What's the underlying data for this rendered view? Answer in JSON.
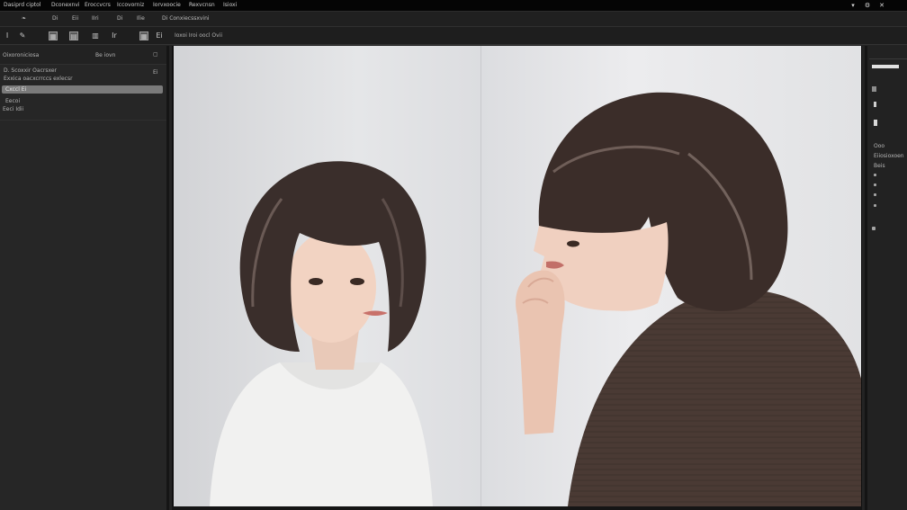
{
  "menubar": {
    "items": [
      "Dasiprd ciptol",
      "Dconexnvi",
      "Eroccvcrs",
      "Iccovorniz",
      "Iorvxoocie",
      "Rexvcnsn",
      "Isioxi"
    ],
    "window_controls": [
      "▾",
      "⚙",
      "✕"
    ]
  },
  "tabs": [
    "❧",
    "Di",
    "Eii",
    "IIri",
    "Di",
    "Ilie",
    "Di Conxiecssxvini"
  ],
  "toolbar": {
    "tool_1": "I",
    "tool_2": "✎",
    "tool_3": "▦",
    "tool_4": "▤",
    "tool_5": "▥",
    "tool_6": "Ir",
    "tool_7": "▦",
    "tool_8": "Ei",
    "label": "Ioxoi Iroi oocl Ovii"
  },
  "left_panel": {
    "header_title": "Oixoroniciosa",
    "header_right": "Be iovn",
    "header_icon": "▢",
    "row_1_label": "D. Scoxxir Oacrsxer",
    "row_1_value": "Ei",
    "row_2_label": "Exxica oacxcrrccs exlecsr",
    "selected_value": "Cxccl Ei",
    "row_3_label": "Eecoi",
    "row_4_label": "Eeci Idii"
  },
  "right_panel": {
    "label_1": "Ooo",
    "label_2": "Eiiosioxoen",
    "label_3": "Beis"
  },
  "accent_colors": {
    "menubar": "#050505",
    "panel": "#262626",
    "selected_field": "#7a7a7a"
  }
}
